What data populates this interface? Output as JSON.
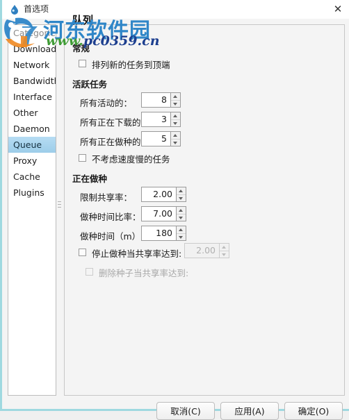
{
  "window": {
    "title": "首选项",
    "icon": "deluge-droplet-icon",
    "close_label": "✕"
  },
  "sidebar": {
    "items": [
      {
        "label": "Categories",
        "selected": false,
        "header": true
      },
      {
        "label": "Downloads",
        "selected": false,
        "header": false
      },
      {
        "label": "Network",
        "selected": false,
        "header": false
      },
      {
        "label": "Bandwidth",
        "selected": false,
        "header": false
      },
      {
        "label": "Interface",
        "selected": false,
        "header": false
      },
      {
        "label": "Other",
        "selected": false,
        "header": false
      },
      {
        "label": "Daemon",
        "selected": false,
        "header": false
      },
      {
        "label": "Queue",
        "selected": true,
        "header": false
      },
      {
        "label": "Proxy",
        "selected": false,
        "header": false
      },
      {
        "label": "Cache",
        "selected": false,
        "header": false
      },
      {
        "label": "Plugins",
        "selected": false,
        "header": false
      }
    ]
  },
  "panel": {
    "title": "队列",
    "sections": {
      "general": {
        "header": "常规",
        "queue_new_to_top": {
          "label": "排列新的任务到顶端",
          "checked": false
        }
      },
      "active": {
        "header": "活跃任务",
        "total_active": {
          "label": "所有活动的：",
          "value": "8"
        },
        "total_downloading": {
          "label": "所有正在下载的：",
          "value": "3"
        },
        "total_seeding": {
          "label": "所有正在做种的：",
          "value": "5"
        },
        "ignore_slow": {
          "label": "不考虑速度慢的任务",
          "checked": false
        }
      },
      "seeding": {
        "header": "正在做种",
        "share_ratio_limit": {
          "label": "限制共享率：",
          "value": "2.00"
        },
        "seed_time_ratio": {
          "label": "做种时间比率：",
          "value": "7.00"
        },
        "seed_time": {
          "label": "做种时间（m）",
          "value": "180"
        },
        "stop_at_ratio": {
          "label": "停止做种当共享率达到:",
          "checked": false,
          "value": "2.00",
          "enabled": false
        },
        "remove_at_ratio": {
          "label": "删除种子当共享率达到:",
          "checked": false,
          "enabled": false
        }
      }
    }
  },
  "footer": {
    "cancel": "取消(C)",
    "apply": "应用(A)",
    "ok": "确定(O)"
  },
  "watermark": {
    "site_name": "河东软件园",
    "url_prefix": "www.",
    "url_rest": "pc0359.cn",
    "colors": {
      "name": "#2f86c8",
      "prefix": "#3f9c35",
      "rest": "#1d3f8f"
    }
  }
}
